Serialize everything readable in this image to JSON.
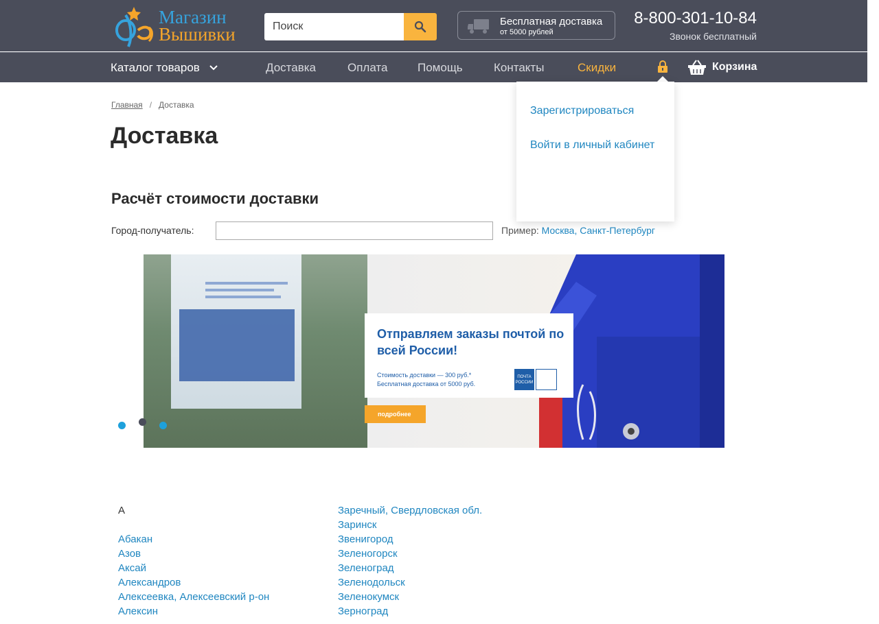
{
  "header": {
    "logo": {
      "line1": "Магазин",
      "line2": "Вышивки",
      "mark": "Фея"
    },
    "search": {
      "placeholder": "Поиск"
    },
    "delivery": {
      "title": "Бесплатная доставка",
      "subtitle": "от 5000 рублей"
    },
    "phone": {
      "number": "8-800-301-10-84",
      "note": "Звонок бесплатный"
    }
  },
  "nav": {
    "catalog": "Каталог товаров",
    "links": [
      "Доставка",
      "Оплата",
      "Помощь",
      "Контакты",
      "Скидки"
    ],
    "cart": "Корзина"
  },
  "account_menu": {
    "items": [
      "Зарегистрироваться",
      "Войти в личный кабинет"
    ]
  },
  "breadcrumb": {
    "home": "Главная",
    "separator": "/",
    "current": "Доставка"
  },
  "page": {
    "title": "Доставка",
    "calc_title": "Расчёт стоимости доставки",
    "city_label": "Город-получатель:",
    "city_value": "",
    "example_prefix": "Пример:",
    "example_1": "Москва,",
    "example_2": "Санкт-Петербург"
  },
  "banner": {
    "title": "Отправляем заказы почтой по всей России!",
    "line1": "Стоимость доставки — 300 руб.*",
    "line2": "Бесплатная доставка от 5000 руб.",
    "logo_line1": "ПОЧТА",
    "logo_line2": "РОССИИ",
    "button": "подробнее",
    "dots": 3,
    "active_dot": 2
  },
  "cities": {
    "col1": [
      "А",
      "",
      "Абакан",
      "Азов",
      "Аксай",
      "Александров",
      "Алексеевка, Алексеевский р-он",
      "Алексин"
    ],
    "col2": [
      "Заречный, Свердловская обл.",
      "Заринск",
      "Звенигород",
      "Зеленогорск",
      "Зеленоград",
      "Зеленодольск",
      "Зеленокумск",
      "Зерноград"
    ]
  },
  "colors": {
    "header_bg": "#4a4d5a",
    "accent": "#f9b43e",
    "link": "#1f86c0"
  }
}
